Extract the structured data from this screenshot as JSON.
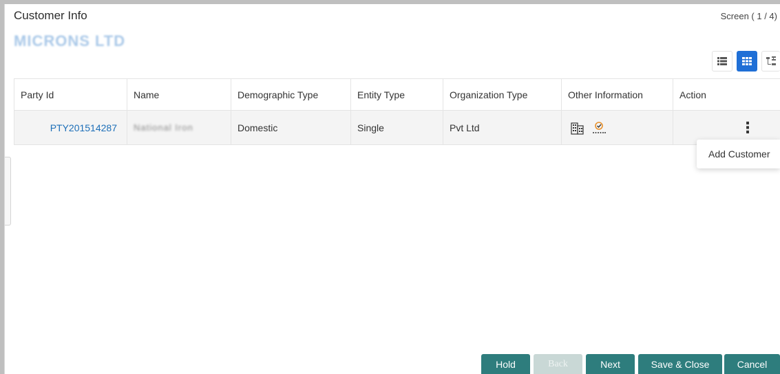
{
  "header": {
    "title": "Customer Info",
    "screen_counter": "Screen ( 1 / 4)",
    "company_name": "MICRONS LTD"
  },
  "view_toggles": [
    {
      "icon": "list-view-icon",
      "active": false
    },
    {
      "icon": "grid-view-icon",
      "active": true
    },
    {
      "icon": "tree-view-icon",
      "active": false
    }
  ],
  "grid": {
    "columns": [
      "Party Id",
      "Name",
      "Demographic Type",
      "Entity Type",
      "Organization Type",
      "Other Information",
      "Action"
    ],
    "rows": [
      {
        "party_id": "PTY201514287",
        "name": "National Iron",
        "demographic_type": "Domestic",
        "entity_type": "Single",
        "organization_type": "Pvt Ltd",
        "other_information_icons": [
          "building-icon",
          "checklist-badge-icon"
        ],
        "action_icon": "kebab-menu-icon"
      }
    ]
  },
  "action_menu": {
    "items": [
      "Add Customer"
    ]
  },
  "footer": {
    "hold": "Hold",
    "back": "Back",
    "next": "Next",
    "save_close": "Save & Close",
    "cancel": "Cancel"
  },
  "colors": {
    "primary_button": "#2e7d7d",
    "disabled_button": "#c9d8d6",
    "link": "#1d6fb8",
    "active_toggle": "#1f6fd6"
  }
}
